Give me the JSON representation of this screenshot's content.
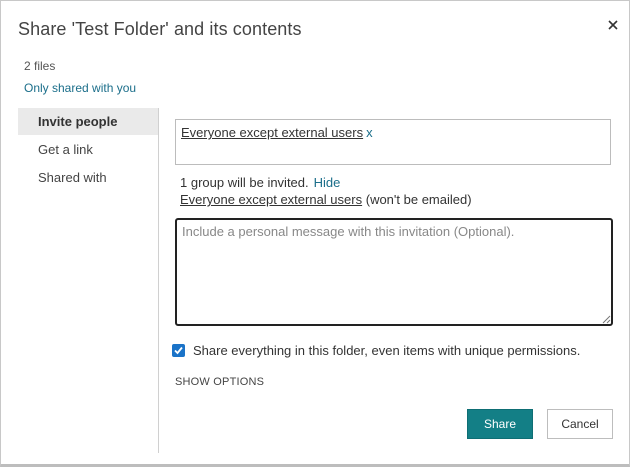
{
  "dialog": {
    "title": "Share 'Test Folder' and its contents",
    "close_icon": "close-icon",
    "files_count": "2 files",
    "shared_status": "Only shared with you"
  },
  "nav": {
    "items": [
      {
        "label": "Invite people",
        "active": true
      },
      {
        "label": "Get a link",
        "active": false
      },
      {
        "label": "Shared with",
        "active": false
      }
    ]
  },
  "invite": {
    "recipient_chip": "Everyone except external users",
    "remove_chip": "x",
    "info_text": "1 group will be invited.",
    "hide_link": "Hide",
    "group_name": "Everyone except external users",
    "not_emailed": "(won't be emailed)",
    "message_placeholder": "Include a personal message with this invitation (Optional).",
    "message_value": "",
    "share_everything_label": "Share everything in this folder, even items with unique permissions.",
    "share_everything_checked": true,
    "show_options": "SHOW OPTIONS"
  },
  "buttons": {
    "share": "Share",
    "cancel": "Cancel"
  },
  "colors": {
    "accent": "#137f86",
    "link": "#1b6e8a",
    "checkbox": "#1a73c8"
  }
}
